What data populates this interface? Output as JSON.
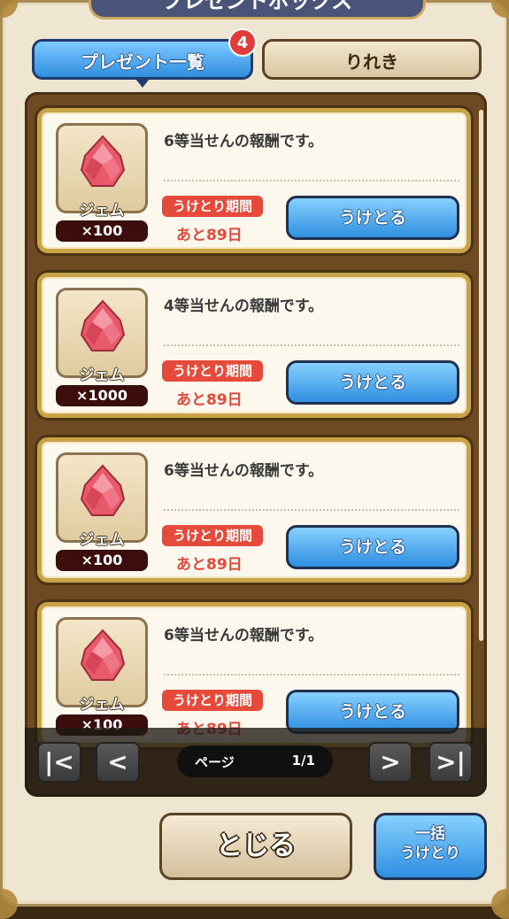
{
  "header": {
    "title": "プレゼントボックス"
  },
  "tabs": [
    {
      "label": "プレゼント一覧",
      "active": true,
      "badge": "4"
    },
    {
      "label": "りれき",
      "active": false
    }
  ],
  "items": [
    {
      "icon": "gem-icon",
      "name": "ジェム",
      "quantity": "×100",
      "message": "6等当せんの報酬です。",
      "period_label": "うけとり期間",
      "remaining": "あと89日",
      "button": "うけとる"
    },
    {
      "icon": "gem-icon",
      "name": "ジェム",
      "quantity": "×1000",
      "message": "4等当せんの報酬です。",
      "period_label": "うけとり期間",
      "remaining": "あと89日",
      "button": "うけとる"
    },
    {
      "icon": "gem-icon",
      "name": "ジェム",
      "quantity": "×100",
      "message": "6等当せんの報酬です。",
      "period_label": "うけとり期間",
      "remaining": "あと89日",
      "button": "うけとる"
    },
    {
      "icon": "gem-icon",
      "name": "ジェム",
      "quantity": "×100",
      "message": "6等当せんの報酬です。",
      "period_label": "うけとり期間",
      "remaining": "あと89日",
      "button": "うけとる"
    }
  ],
  "pager": {
    "first": "|<",
    "prev": "<",
    "next": ">",
    "last": ">|",
    "label": "ページ",
    "page": "1/1"
  },
  "footer": {
    "close_label": "とじる",
    "bulk_line1": "一括",
    "bulk_line2": "うけとり"
  },
  "colors": {
    "accent_blue": "#2f8fe0",
    "badge_red": "#e23b3b",
    "period_red": "#e64a3b",
    "gold": "#c9a347"
  }
}
